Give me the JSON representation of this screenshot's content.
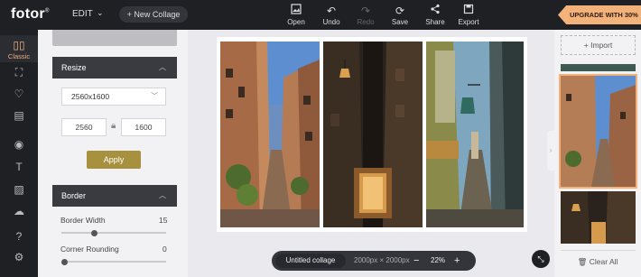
{
  "topbar": {
    "logo": "fotor",
    "logo_mark": "®",
    "edit_label": "EDIT",
    "new_collage_label": "+ New Collage",
    "tools": [
      {
        "icon": "open-icon",
        "label": "Open",
        "enabled": true
      },
      {
        "icon": "undo-icon",
        "label": "Undo",
        "enabled": true
      },
      {
        "icon": "redo-icon",
        "label": "Redo",
        "enabled": false
      },
      {
        "icon": "save-icon",
        "label": "Save",
        "enabled": true
      },
      {
        "icon": "share-icon",
        "label": "Share",
        "enabled": true
      },
      {
        "icon": "export-icon",
        "label": "Export",
        "enabled": true
      }
    ],
    "upgrade_label": "UPGRADE WITH 30% OFF"
  },
  "rail": {
    "active_label": "Classic"
  },
  "panel": {
    "resize": {
      "title": "Resize",
      "preset": "2560x1600",
      "width": "2560",
      "height": "1600",
      "apply_label": "Apply"
    },
    "border": {
      "title": "Border",
      "border_width_label": "Border Width",
      "border_width_value": "15",
      "border_width_level": 0.3,
      "corner_rounding_label": "Corner Rounding",
      "corner_rounding_value": "0",
      "corner_rounding_level": 0.0
    }
  },
  "canvas": {
    "collage_name": "Untitled collage",
    "dimensions": "2000px × 2000px",
    "zoom": "22%"
  },
  "right_panel": {
    "import_label": "+ Import",
    "clear_all_label": "Clear All"
  },
  "colors": {
    "accent": "#f3b27a",
    "apply": "#a7913f",
    "dark": "#1f2024"
  }
}
